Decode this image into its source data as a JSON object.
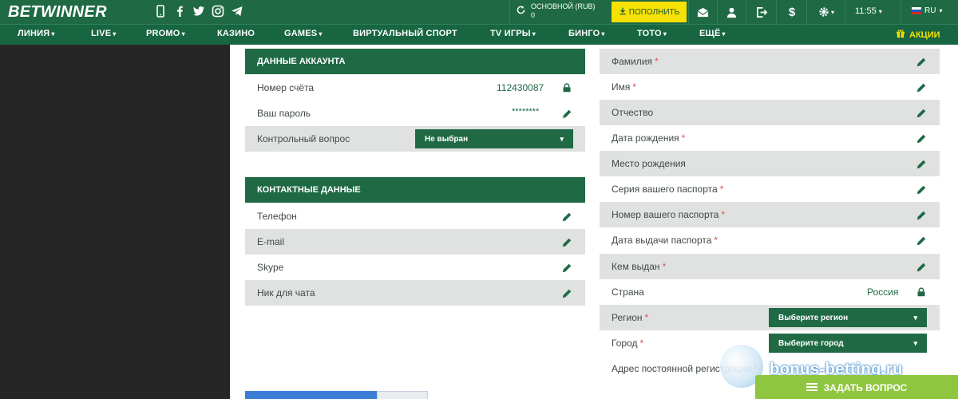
{
  "brand": {
    "part1": "BET",
    "part2": "WINNER"
  },
  "topbar": {
    "balance_label": "ОСНОВНОЙ (RUB)",
    "balance_value": "0",
    "deposit_label": "ПОПОЛНИТЬ",
    "time": "11:55",
    "lang": "RU"
  },
  "nav": {
    "items": [
      "ЛИНИЯ",
      "LIVE",
      "PROMO",
      "КАЗИНО",
      "GAMES",
      "ВИРТУАЛЬНЫЙ СПОРТ",
      "TV ИГРЫ",
      "БИНГО",
      "ТОТО",
      "ЕЩЁ"
    ],
    "promo": "АКЦИИ"
  },
  "account": {
    "header": "ДАННЫЕ АККАУНТА",
    "account_number_label": "Номер счёта",
    "account_number_value": "112430087",
    "password_label": "Ваш пароль",
    "password_value": "********",
    "security_question_label": "Контрольный вопрос",
    "security_question_value": "Не выбран"
  },
  "contacts": {
    "header": "КОНТАКТНЫЕ ДАННЫЕ",
    "phone_label": "Телефон",
    "email_label": "E-mail",
    "skype_label": "Skype",
    "nick_label": "Ник для чата"
  },
  "personal": {
    "surname_label": "Фамилия",
    "name_label": "Имя",
    "patronymic_label": "Отчество",
    "birthdate_label": "Дата рождения",
    "birthplace_label": "Место рождения",
    "passport_series_label": "Серия вашего паспорта",
    "passport_number_label": "Номер вашего паспорта",
    "passport_date_label": "Дата выдачи паспорта",
    "issued_by_label": "Кем выдан",
    "country_label": "Страна",
    "country_value": "Россия",
    "region_label": "Регион",
    "region_placeholder": "Выберите регион",
    "city_label": "Город",
    "city_placeholder": "Выберите город",
    "address_label": "Адрес постоянной регистрации"
  },
  "required_mark": "*",
  "support_label": "ЗАДАТЬ ВОПРОС",
  "watermark": "bonus-betting.ru",
  "colors": {
    "brand_green": "#1f6a45",
    "accent_yellow": "#f6e100",
    "support_green": "#8ec63f"
  }
}
